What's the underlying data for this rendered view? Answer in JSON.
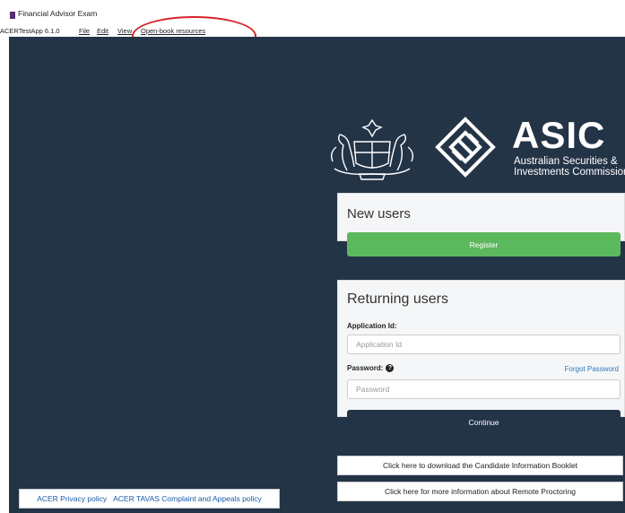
{
  "window": {
    "title": "Financial Advisor Exam"
  },
  "menubar": {
    "app_version": "ACERTestApp 6.1.0",
    "items": [
      "File",
      "Edit",
      "View",
      "Open-book resources"
    ]
  },
  "logo": {
    "asic": "ASIC",
    "line1": "Australian Securities &",
    "line2": "Investments Commission"
  },
  "new_users": {
    "title": "New users",
    "register_label": "Register"
  },
  "returning_users": {
    "title": "Returning users",
    "app_id_label": "Application Id:",
    "app_id_placeholder": "Application Id",
    "password_label": "Password:",
    "forgot_label": "Forgot Password",
    "password_placeholder": "Password",
    "continue_label": "Continue"
  },
  "info_buttons": {
    "booklet": "Click here to download the Candidate Information Booklet",
    "proctoring": "Click here for more information about Remote Proctoring"
  },
  "footer": {
    "privacy": "ACER Privacy policy",
    "complaints": "ACER TAVAS Complaint and Appeals policy"
  },
  "colors": {
    "background": "#243447",
    "register": "#5cb85c",
    "continue": "#243447",
    "link": "#337ab7",
    "annotation": "#d8232a"
  }
}
